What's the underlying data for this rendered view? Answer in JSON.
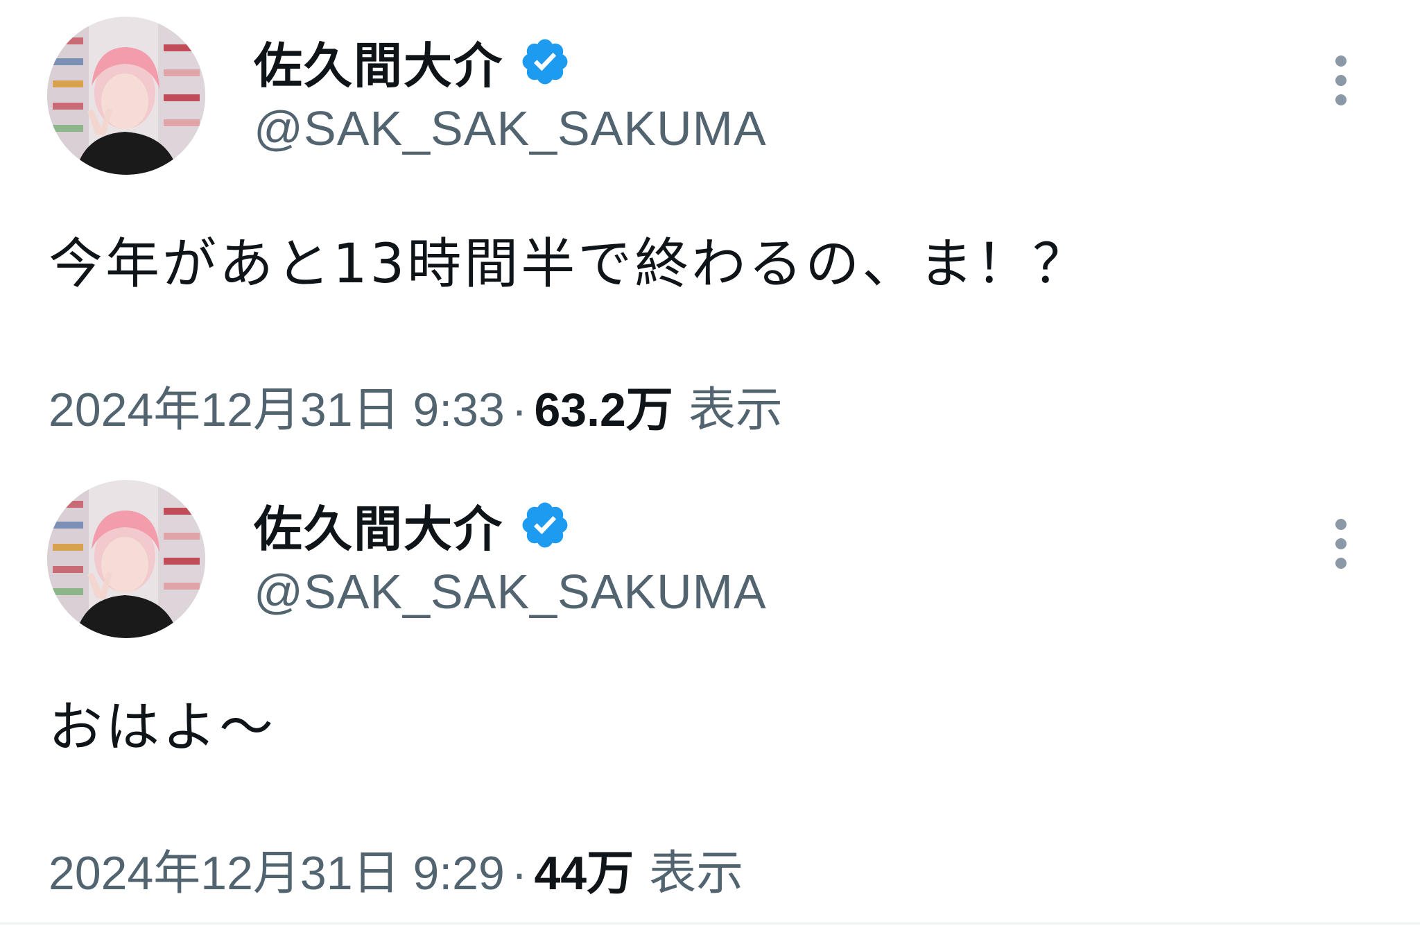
{
  "tweets": [
    {
      "display_name": "佐久間大介",
      "handle": "@SAK_SAK_SAKUMA",
      "text": "今年があと13時間半で終わるの、ま！？",
      "timestamp": "2024年12月31日 9:33",
      "separator": "·",
      "views_count": "63.2万",
      "views_label": "表示",
      "verified_icon": "verified-badge-icon",
      "more_icon": "more-vertical-icon"
    },
    {
      "display_name": "佐久間大介",
      "handle": "@SAK_SAK_SAKUMA",
      "text": "おはよ〜",
      "timestamp": "2024年12月31日 9:29",
      "separator": "·",
      "views_count": "44万",
      "views_label": "表示",
      "verified_icon": "verified-badge-icon",
      "more_icon": "more-vertical-icon"
    }
  ],
  "colors": {
    "primary_text": "#0f1419",
    "secondary_text": "#536471",
    "verified_blue": "#1d9bf0",
    "more_icon": "#8b98a5",
    "background": "#ffffff"
  }
}
